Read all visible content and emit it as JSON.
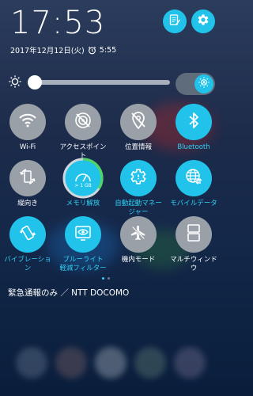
{
  "status": {
    "time": "17:53",
    "date": "2017年12月12日(火)",
    "alarm_time": "5:55"
  },
  "colors": {
    "accent": "#21c3ea",
    "tile_off": "#9aa0a8",
    "background": "#1c2b4a"
  },
  "brightness": {
    "level": 0.04,
    "auto": true
  },
  "tiles": [
    {
      "label": "Wi-Fi",
      "on": false,
      "icon": "wifi-icon"
    },
    {
      "label": "アクセスポイン\nト",
      "on": false,
      "icon": "hotspot-off-icon"
    },
    {
      "label": "位置情報",
      "on": false,
      "icon": "location-off-icon"
    },
    {
      "label": "Bluetooth",
      "on": true,
      "icon": "bluetooth-icon"
    },
    {
      "label": "縦向き",
      "on": false,
      "icon": "rotation-lock-icon"
    },
    {
      "label": "メモリ解放",
      "on": true,
      "icon": "memory-boost-icon",
      "gauge_text": "> 1 GB"
    },
    {
      "label": "自動起動マネー\nジャー",
      "on": true,
      "icon": "gear-icon"
    },
    {
      "label": "モバイルデータ",
      "on": true,
      "icon": "globe-icon"
    },
    {
      "label": "バイブレーショ\nン",
      "on": true,
      "icon": "vibration-icon"
    },
    {
      "label": "ブルーライト\n軽減フィルター",
      "on": true,
      "icon": "eye-icon"
    },
    {
      "label": "機内モード",
      "on": false,
      "icon": "airplane-icon"
    },
    {
      "label": "マルチウィンド\nウ",
      "on": false,
      "icon": "multiwindow-icon"
    }
  ],
  "carrier": "緊急通報のみ ／ NTT DOCOMO"
}
